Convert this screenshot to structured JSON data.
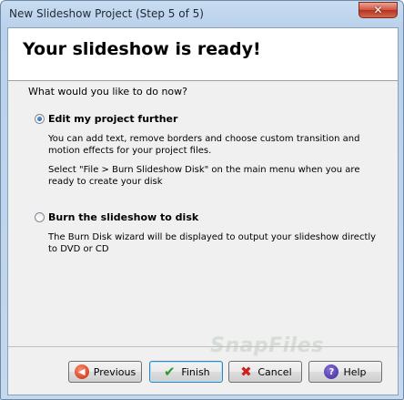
{
  "window": {
    "title": "New Slideshow Project (Step 5 of 5)",
    "close_glyph": "✕"
  },
  "header": {
    "title": "Your slideshow is ready!"
  },
  "question": "What would you like to do now?",
  "options": [
    {
      "label": "Edit my project further",
      "checked": true,
      "description_lines": [
        "You can add text, remove borders and choose custom transition and",
        "motion effects for your project files."
      ],
      "note_lines": [
        "Select \"File > Burn Slideshow Disk\" on the main menu when you are",
        "ready to create your disk"
      ]
    },
    {
      "label": "Burn the slideshow to disk",
      "checked": false,
      "description_lines": [
        "The Burn Disk wizard will be displayed to output your slideshow directly",
        "to DVD or CD"
      ]
    }
  ],
  "buttons": {
    "previous": {
      "label": "Previous",
      "icon": "arrow-left-icon"
    },
    "finish": {
      "label": "Finish",
      "icon": "checkmark-icon"
    },
    "cancel": {
      "label": "Cancel",
      "icon": "x-icon"
    },
    "help": {
      "label": "Help",
      "icon": "question-icon"
    }
  },
  "watermark": "SnapFiles",
  "colors": {
    "title_bar": "#b9d1ea",
    "close_button": "#c8412c",
    "dialog_background": "#f0f0f0",
    "header_background": "#ffffff"
  }
}
